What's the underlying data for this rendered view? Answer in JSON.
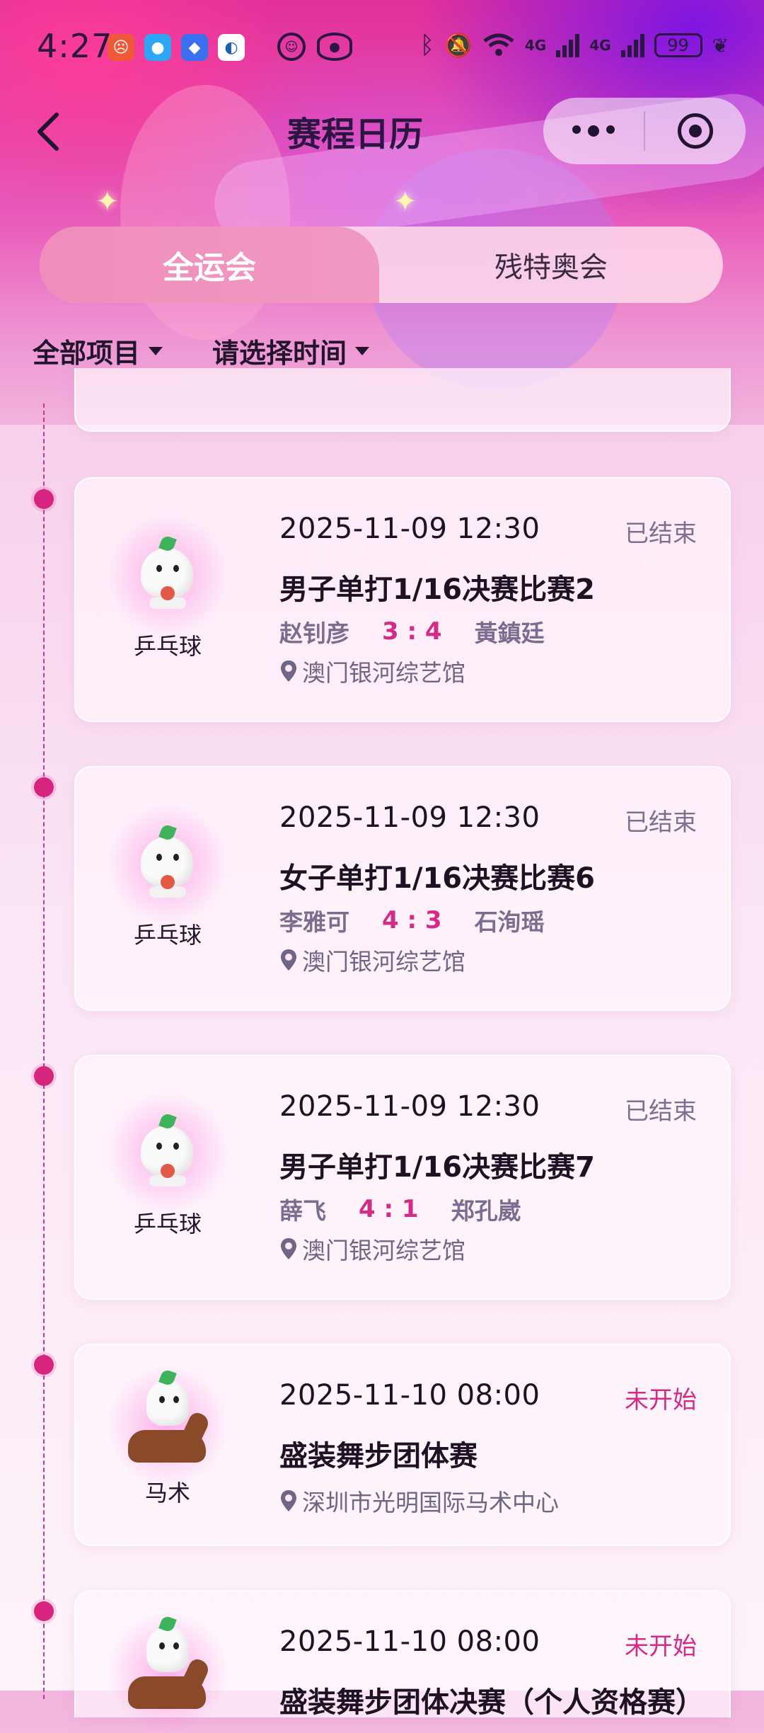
{
  "status_bar": {
    "time": "4:27",
    "network_1": "4G",
    "network_2": "4G",
    "battery": "99"
  },
  "nav": {
    "title": "赛程日历"
  },
  "tabs": [
    {
      "label": "全运会",
      "active": true
    },
    {
      "label": "残特奥会",
      "active": false
    }
  ],
  "filters": {
    "sport": "全部项目",
    "time": "请选择时间"
  },
  "colors": {
    "accent": "#d12d88",
    "ended": "#7c7190",
    "timeline": "#d6247f"
  },
  "matches": [
    {
      "datetime": "2025-11-09 12:30",
      "status": "已结束",
      "sport": "乒乓球",
      "title": "男子单打1/16决赛比赛2",
      "player1": "赵钊彦",
      "score": "3 : 4",
      "player2": "黃鎮廷",
      "venue": "澳门银河综艺馆"
    },
    {
      "datetime": "2025-11-09 12:30",
      "status": "已结束",
      "sport": "乒乓球",
      "title": "女子单打1/16决赛比赛6",
      "player1": "李雅可",
      "score": "4 : 3",
      "player2": "石洵瑶",
      "venue": "澳门银河综艺馆"
    },
    {
      "datetime": "2025-11-09 12:30",
      "status": "已结束",
      "sport": "乒乓球",
      "title": "男子单打1/16决赛比赛7",
      "player1": "薛飞",
      "score": "4 : 1",
      "player2": "郑孔崴",
      "venue": "澳门银河综艺馆"
    },
    {
      "datetime": "2025-11-10 08:00",
      "status": "未开始",
      "sport": "马术",
      "title": "盛装舞步团体赛",
      "venue": "深圳市光明国际马术中心"
    },
    {
      "datetime": "2025-11-10 08:00",
      "status": "未开始",
      "sport": "马术",
      "title": "盛装舞步团体决赛（个人资格赛）"
    }
  ]
}
